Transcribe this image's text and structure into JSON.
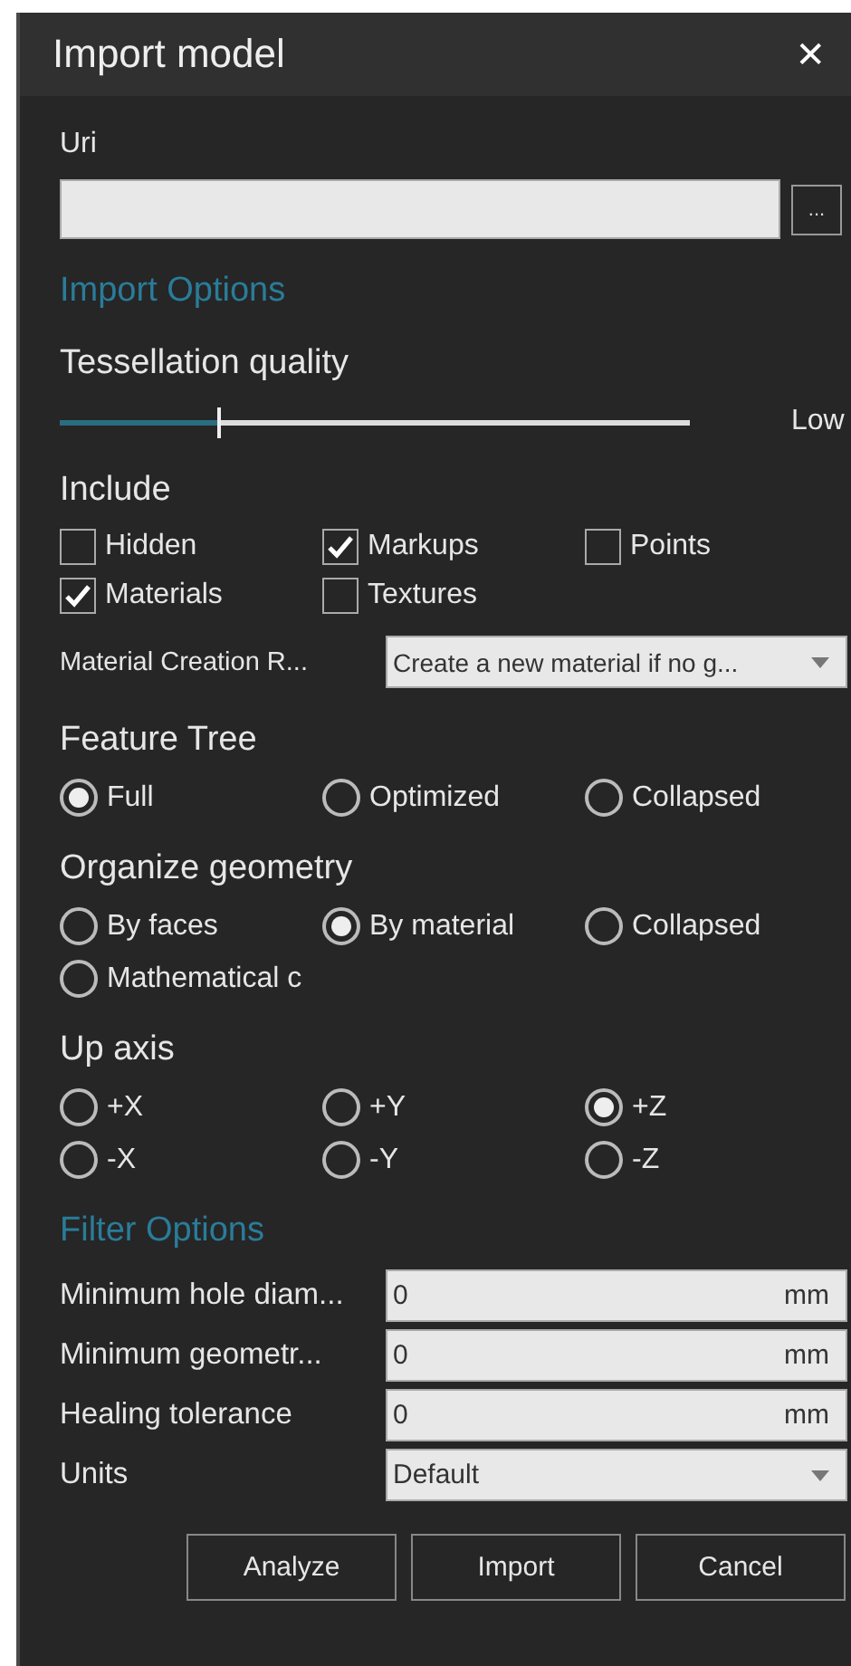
{
  "window": {
    "title": "Import model",
    "close": "✕"
  },
  "uri": {
    "label": "Uri",
    "browse": "..."
  },
  "import_options": {
    "heading": "Import Options",
    "tessellation": {
      "label": "Tessellation quality",
      "level": 0.25,
      "reading": "Low"
    },
    "include": {
      "label": "Include",
      "items": [
        {
          "label": "Hidden",
          "checked": false
        },
        {
          "label": "Markups",
          "checked": true
        },
        {
          "label": "Points",
          "checked": false
        },
        {
          "label": "Materials",
          "checked": true
        },
        {
          "label": "Textures",
          "checked": false
        }
      ]
    },
    "material_creation": {
      "label": "Material Creation R...",
      "value": "Create a new material if no g..."
    },
    "groups": [
      {
        "label": "Feature Tree",
        "options": [
          {
            "label": "Full",
            "selected": true
          },
          {
            "label": "Optimized",
            "selected": false
          },
          {
            "label": "Collapsed",
            "selected": false
          }
        ]
      },
      {
        "label": "Organize geometry",
        "options": [
          {
            "label": "By faces",
            "selected": false
          },
          {
            "label": "By material",
            "selected": true
          },
          {
            "label": "Collapsed",
            "selected": false
          },
          {
            "label": "Mathematical c",
            "selected": false
          }
        ]
      },
      {
        "label": "Up axis",
        "options": [
          {
            "label": "+X",
            "selected": false
          },
          {
            "label": "+Y",
            "selected": false
          },
          {
            "label": "+Z",
            "selected": true
          },
          {
            "label": "-X",
            "selected": false
          },
          {
            "label": "-Y",
            "selected": false
          },
          {
            "label": "-Z",
            "selected": false
          }
        ]
      }
    ]
  },
  "filter_options": {
    "heading": "Filter Options",
    "fields": [
      {
        "kind": "number",
        "label": "Minimum hole diam...",
        "value": "0",
        "unit": "mm"
      },
      {
        "kind": "number",
        "label": "Minimum geometr...",
        "value": "0",
        "unit": "mm"
      },
      {
        "kind": "number",
        "label": "Healing tolerance",
        "value": "0",
        "unit": "mm"
      },
      {
        "kind": "dropdown",
        "label": "Units",
        "value": "Default"
      }
    ]
  },
  "buttons": [
    "Analyze",
    "Import",
    "Cancel"
  ]
}
